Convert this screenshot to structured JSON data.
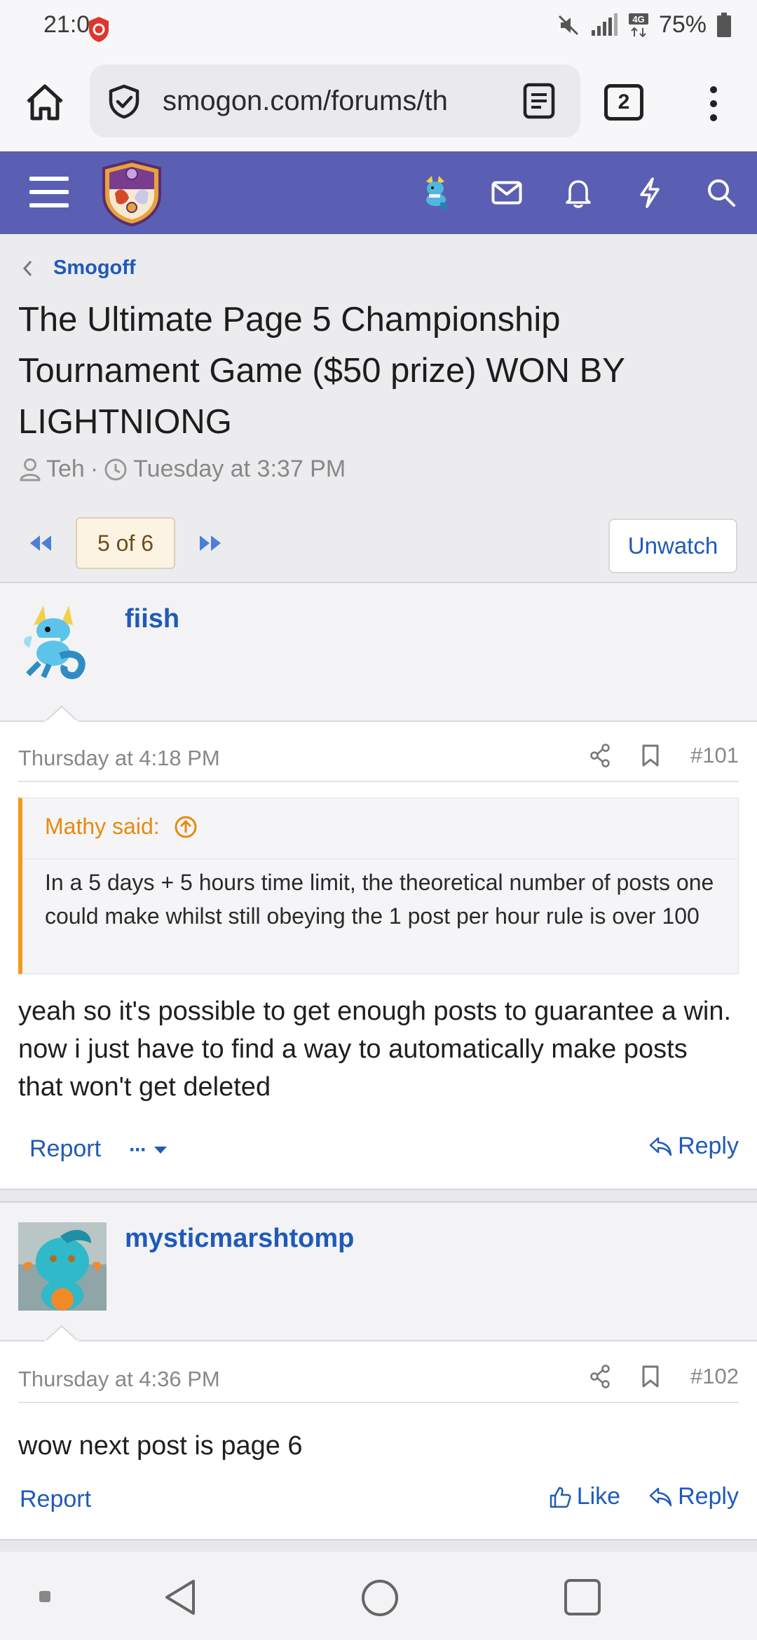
{
  "status_bar": {
    "time": "21:0",
    "battery": "75%",
    "network": "4G",
    "icons": [
      "notification-shield-icon",
      "mute-icon",
      "signal-icon",
      "network-4g-icon",
      "battery-icon"
    ]
  },
  "browser": {
    "url": "smogon.com/forums/th",
    "tab_count": "2",
    "icons": [
      "home-icon",
      "shield-check-icon",
      "reader-mode-icon",
      "tabs-icon",
      "more-vertical-icon"
    ]
  },
  "forum_header": {
    "background_color": "#5b5fb3",
    "icons": [
      "hamburger-icon",
      "smogon-logo",
      "user-avatar-icon",
      "inbox-icon",
      "bell-icon",
      "lightning-icon",
      "search-icon"
    ]
  },
  "thread": {
    "breadcrumb": "Smogoff",
    "title": "The Ultimate Page 5 Championship Tournament Game ($50 prize) WON BY LIGHTNIONG",
    "author": "Teh",
    "separator": "·",
    "started": "Tuesday at 3:37 PM",
    "page_indicator": "5 of 6",
    "unwatch_label": "Unwatch"
  },
  "posts": [
    {
      "username": "fiish",
      "date": "Thursday at 4:18 PM",
      "number": "#101",
      "quote": {
        "author": "Mathy said:",
        "text": "In a 5 days + 5 hours time limit, the theoretical number of posts one could make whilst still obeying the 1 post per hour rule is over 100"
      },
      "body": "yeah so it's possible to get enough posts to guarantee a win. now i just have to find a way to automatically make posts that won't get deleted",
      "report_label": "Report",
      "more_label": "···",
      "reply_label": "Reply"
    },
    {
      "username": "mysticmarshtomp",
      "date": "Thursday at 4:36 PM",
      "number": "#102",
      "body": "wow next post is page 6",
      "report_label": "Report",
      "like_label": "Like",
      "reply_label": "Reply"
    }
  ],
  "colors": {
    "link": "#1f5ab8",
    "quote_accent": "#f39a1a",
    "header": "#5b5fb3"
  },
  "nav_bar": {
    "icons": [
      "nav-dot-icon",
      "back-icon",
      "home-circle-icon",
      "recents-icon"
    ]
  }
}
